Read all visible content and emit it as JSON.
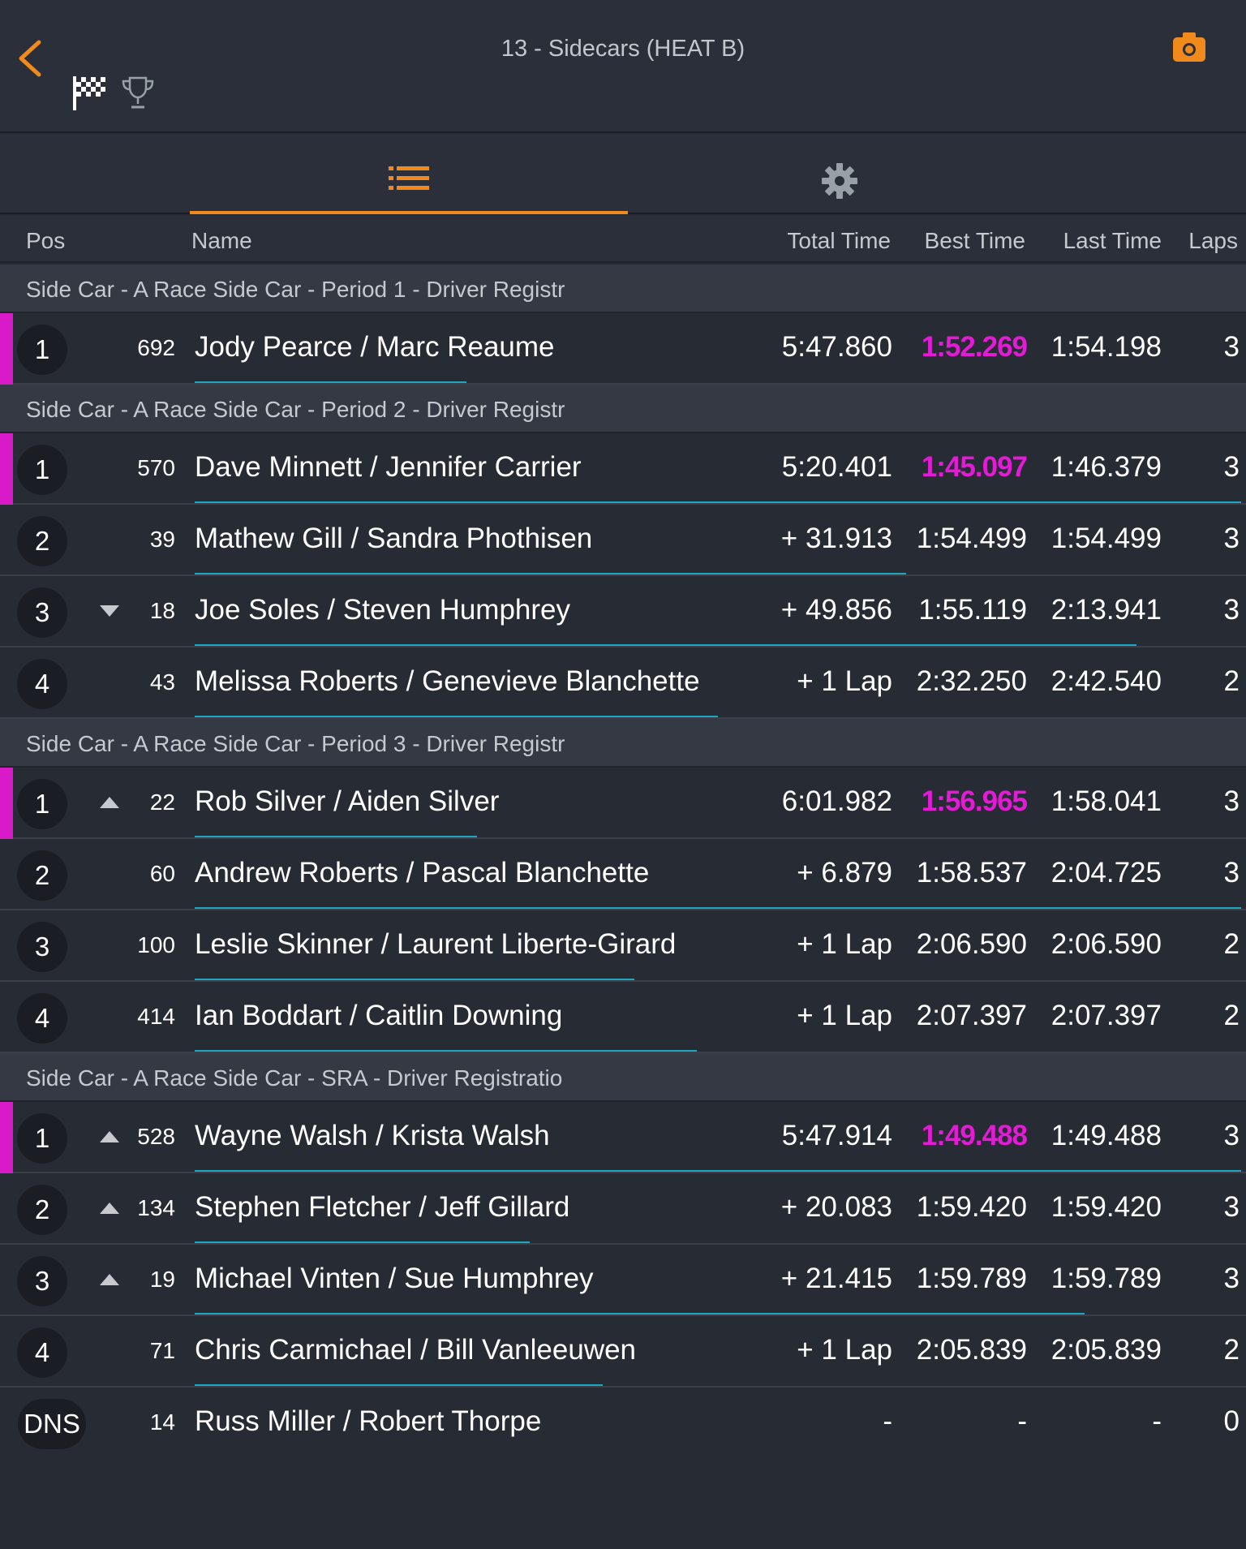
{
  "header": {
    "title": "13 - Sidecars (HEAT B)",
    "icons": [
      "back-chevron-icon",
      "checkered-flag-icon",
      "trophy-icon",
      "camera-icon"
    ],
    "accent_color": "#f08a1c"
  },
  "tabs": [
    {
      "icon": "list-icon",
      "active": true
    },
    {
      "icon": "gear-icon",
      "active": false
    }
  ],
  "columns": {
    "pos": "Pos",
    "name": "Name",
    "total": "Total Time",
    "best": "Best Time",
    "last": "Last Time",
    "laps": "Laps"
  },
  "colors": {
    "best_highlight": "#e41ad6",
    "progress": "#1fa6c0",
    "leader_bar": "#d91ac8"
  },
  "groups": [
    {
      "title": "Side Car - A Race Side Car - Period 1 - Driver Registr",
      "rows": [
        {
          "pos": "1",
          "trend": "",
          "num": "692",
          "name": "Jody Pearce /  Marc Reaume",
          "total": "5:47.860",
          "best": "1:52.269",
          "best_hl": true,
          "last": "1:54.198",
          "laps": "3",
          "progress": 0.26
        }
      ]
    },
    {
      "title": "Side Car - A Race Side Car - Period 2 - Driver Registr",
      "rows": [
        {
          "pos": "1",
          "trend": "",
          "num": "570",
          "name": "Dave Minnett /  Jennifer Carrier",
          "total": "5:20.401",
          "best": "1:45.097",
          "best_hl": true,
          "last": "1:46.379",
          "laps": "3",
          "progress": 1.0
        },
        {
          "pos": "2",
          "trend": "",
          "num": "39",
          "name": "Mathew Gill /  Sandra Phothisen",
          "total": "+ 31.913",
          "best": "1:54.499",
          "best_hl": false,
          "last": "1:54.499",
          "laps": "3",
          "progress": 0.68
        },
        {
          "pos": "3",
          "trend": "down",
          "num": "18",
          "name": "Joe Soles /  Steven Humphrey",
          "total": "+ 49.856",
          "best": "1:55.119",
          "best_hl": false,
          "last": "2:13.941",
          "laps": "3",
          "progress": 0.9
        },
        {
          "pos": "4",
          "trend": "",
          "num": "43",
          "name": "Melissa Roberts /  Genevieve Blanchette",
          "total": "+ 1 Lap",
          "best": "2:32.250",
          "best_hl": false,
          "last": "2:42.540",
          "laps": "2",
          "progress": 0.5
        }
      ]
    },
    {
      "title": "Side Car - A Race Side Car - Period 3 - Driver Registr",
      "rows": [
        {
          "pos": "1",
          "trend": "up",
          "num": "22",
          "name": "Rob Silver /  Aiden Silver",
          "total": "6:01.982",
          "best": "1:56.965",
          "best_hl": true,
          "last": "1:58.041",
          "laps": "3",
          "progress": 0.27
        },
        {
          "pos": "2",
          "trend": "",
          "num": "60",
          "name": "Andrew Roberts /  Pascal Blanchette",
          "total": "+ 6.879",
          "best": "1:58.537",
          "best_hl": false,
          "last": "2:04.725",
          "laps": "3",
          "progress": 1.0
        },
        {
          "pos": "3",
          "trend": "",
          "num": "100",
          "name": "Leslie Skinner /  Laurent Liberte-Girard",
          "total": "+ 1 Lap",
          "best": "2:06.590",
          "best_hl": false,
          "last": "2:06.590",
          "laps": "2",
          "progress": 0.42
        },
        {
          "pos": "4",
          "trend": "",
          "num": "414",
          "name": "Ian Boddart /  Caitlin Downing",
          "total": "+ 1 Lap",
          "best": "2:07.397",
          "best_hl": false,
          "last": "2:07.397",
          "laps": "2",
          "progress": 0.48
        }
      ]
    },
    {
      "title": "Side Car - A Race Side Car - SRA - Driver Registratio",
      "rows": [
        {
          "pos": "1",
          "trend": "up",
          "num": "528",
          "name": "Wayne Walsh /  Krista Walsh",
          "total": "5:47.914",
          "best": "1:49.488",
          "best_hl": true,
          "last": "1:49.488",
          "laps": "3",
          "progress": 1.0
        },
        {
          "pos": "2",
          "trend": "up",
          "num": "134",
          "name": "Stephen Fletcher /  Jeff Gillard",
          "total": "+ 20.083",
          "best": "1:59.420",
          "best_hl": false,
          "last": "1:59.420",
          "laps": "3",
          "progress": 0.32
        },
        {
          "pos": "3",
          "trend": "up",
          "num": "19",
          "name": "Michael Vinten /  Sue Humphrey",
          "total": "+ 21.415",
          "best": "1:59.789",
          "best_hl": false,
          "last": "1:59.789",
          "laps": "3",
          "progress": 0.85
        },
        {
          "pos": "4",
          "trend": "",
          "num": "71",
          "name": "Chris Carmichael /  Bill Vanleeuwen",
          "total": "+ 1 Lap",
          "best": "2:05.839",
          "best_hl": false,
          "last": "2:05.839",
          "laps": "2",
          "progress": 0.39
        },
        {
          "pos": "DNS",
          "trend": "",
          "num": "14",
          "name": "Russ Miller /  Robert Thorpe",
          "total": "-",
          "best": "-",
          "best_hl": false,
          "last": "-",
          "laps": "0",
          "progress": 0
        }
      ]
    }
  ]
}
